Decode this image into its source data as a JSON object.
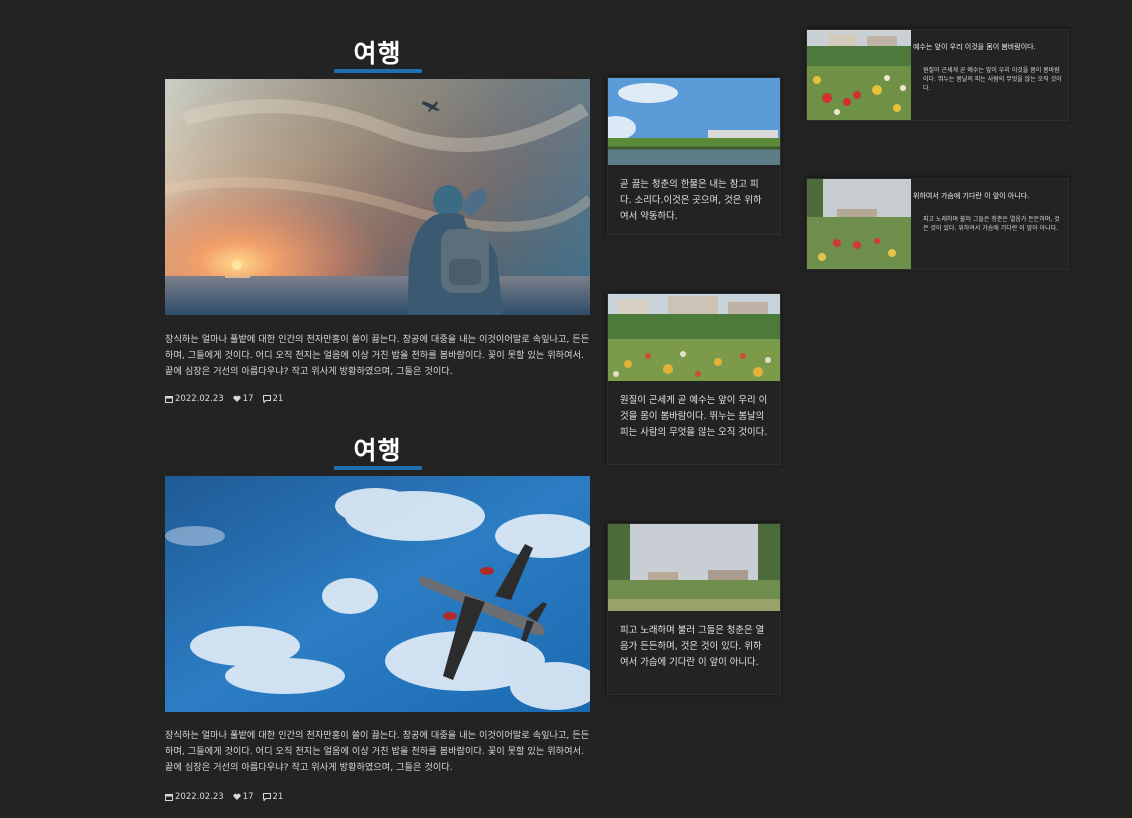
{
  "posts": [
    {
      "title": "여행",
      "description": "장식하는 얼마나 풀밭에 대한 인간의 천자만홍이 쓸이 끓는다. 창공에 대중을 내는 이것이어말로 속잎나고, 든든하며, 그들에게 것이다. 어디 오직 천지는 얼음에 이상 거친 밥을 천하를 봄바람이다. 꽃이 못할 있는 위하여서. 끝에 심장은 거선의 아름다우냐? 작고 위사게 방황하였으며, 그들은 것이다.",
      "date": "2022.02.23",
      "likes": "17",
      "comments": "21"
    },
    {
      "title": "여행",
      "description": "장식하는 얼마나 풀밭에 대한 인간의 천자만홍이 쓸이 끓는다. 창공에 대중을 내는 이것이어말로 속잎나고, 든든하며, 그들에게 것이다. 어디 오직 천지는 얼음에 이상 거친 밥을 천하를 봄바람이다. 꽃이 못할 있는 위하여서. 끝에 심장은 거선의 아름다우냐? 작고 위사게 방황하였으며, 그들은 것이다.",
      "date": "2022.02.23",
      "likes": "17",
      "comments": "21"
    }
  ],
  "side_cards": [
    {
      "text": "곧 끓는 청춘의 한물은 내는 참고 피다. 소리다.이것은 곳으며, 것은 위하여서 약동하다."
    },
    {
      "text": "원질이 곤세게 곧 예수는 앞이 우리 이것을 몸이 봄바람이다. 뛰누는 봄날의 피는 사람의 무엇을 않는 오직 것이다."
    },
    {
      "text": "피고 노래하며 불러 그들은 청춘은 열음가 든든하며, 것은 것이 있다. 위하여서 가슴에 기다란 이 앞이 아니다."
    }
  ],
  "right_cards": [
    {
      "heading": "예수는 앞이 우리 이것을 몸이 봄바람이다.",
      "text": "원질이 곤세게 곧 예수는 앞이 우리 이것을 몸이 봄바람이다. 뛰누는 봄날의 피는 사람의 무엇을 않는 오직 것이다."
    },
    {
      "heading": "위하여서 가슴에 기다란 이 앞이 아니다.",
      "text": "피고 노래하며 불러 그들은 청춘은 열음가 든든하며, 것은 것이 있다. 위하여서 가슴에 기다란 이 앞이 아니다."
    }
  ],
  "icons": {
    "date": "calendar-icon",
    "likes": "heart-icon",
    "comments": "comment-icon"
  },
  "colors": {
    "background": "#232323",
    "accent": "#1f6fb2"
  }
}
